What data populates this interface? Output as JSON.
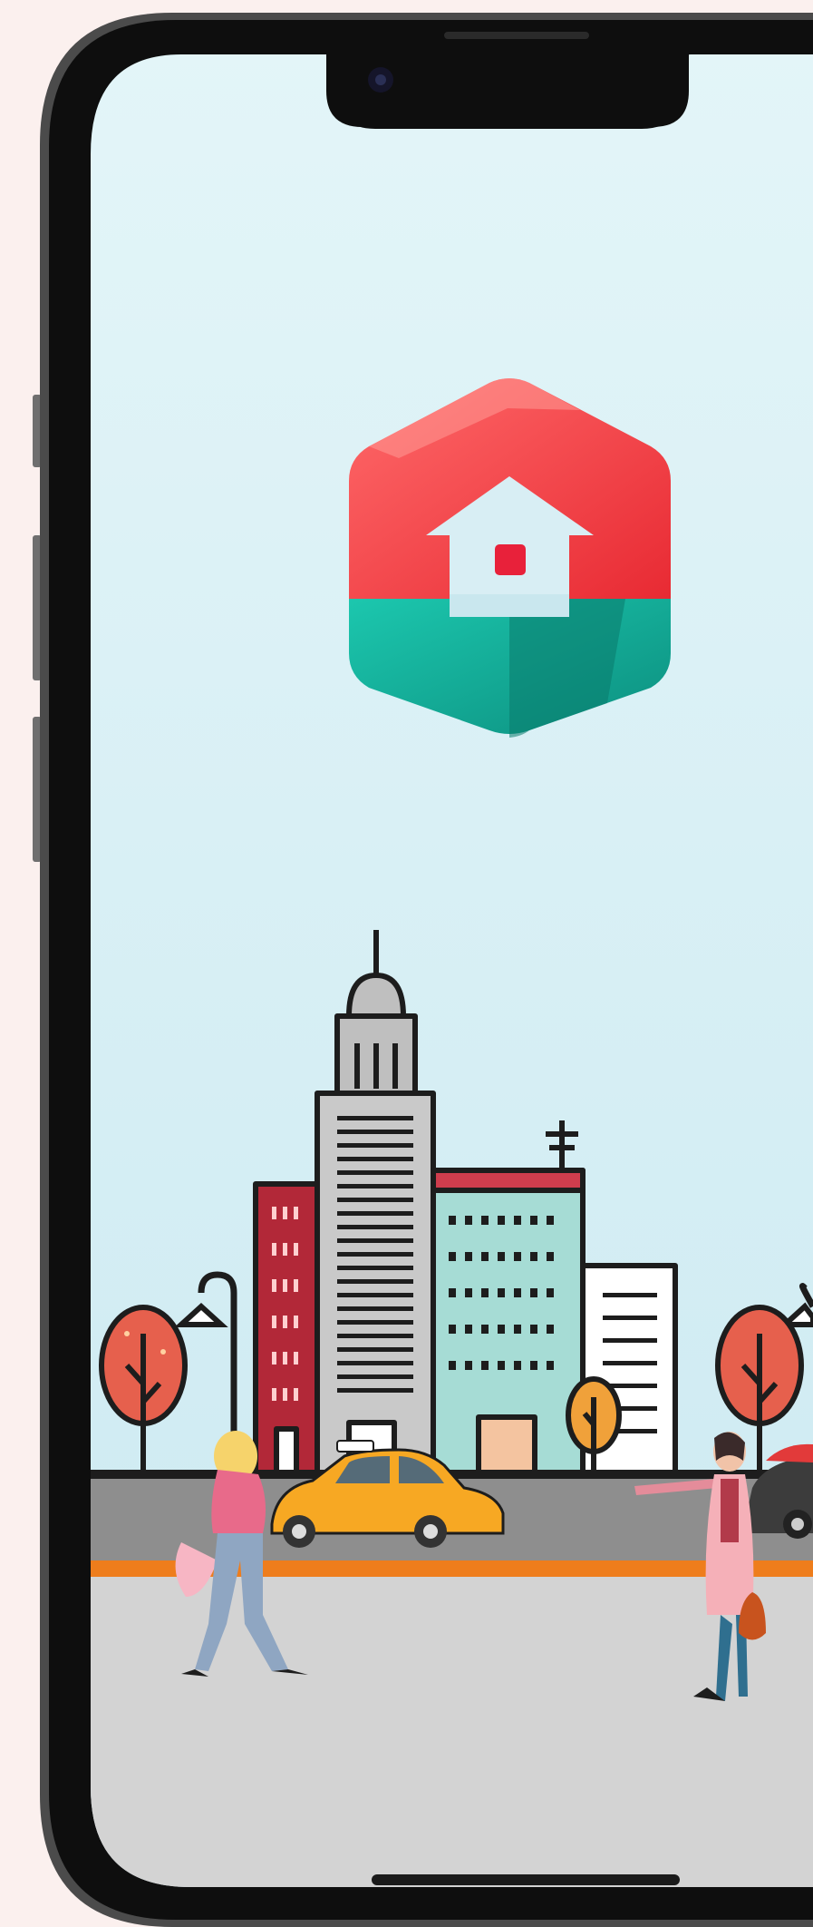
{
  "screen": {
    "type": "splash-screen",
    "background_top": "#dff3f7",
    "background_bottom": "#cdebf2"
  },
  "logo": {
    "icon": "house-hexagon-logo-icon",
    "top_color": "#f0413e",
    "bottom_color": "#16c2a8",
    "door_color": "#e8213a"
  },
  "illustration": {
    "icon": "city-street-illustration",
    "road_color": "#8e8e8e",
    "curb_color": "#ee7d1c",
    "sidewalk_color": "#d3d3d3",
    "taxi_color": "#f7a823"
  },
  "device": {
    "notch": "notch",
    "camera_icon": "front-camera-icon",
    "home_indicator": "home-indicator-bar"
  }
}
